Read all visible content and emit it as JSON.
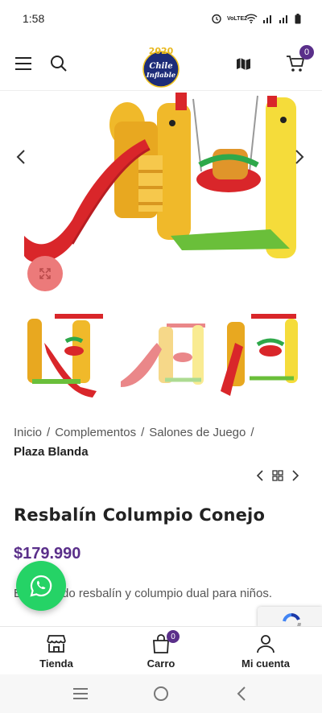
{
  "status_bar": {
    "time": "1:58",
    "network": "VoLTE2"
  },
  "header": {
    "logo_text": "Chile Inflable",
    "logo_year": "2020",
    "cart_count": "0"
  },
  "breadcrumb": {
    "items": [
      "Inicio",
      "Complementos",
      "Salones de Juego"
    ],
    "current": "Plaza Blanda"
  },
  "product": {
    "title": "Resbalín Columpio Conejo",
    "price": "$179.990",
    "description": "Entretenido resbalín y columpio dual para niños."
  },
  "bottom_nav": {
    "items": [
      {
        "label": "Tienda",
        "icon": "store-icon"
      },
      {
        "label": "Carro",
        "icon": "cart-icon",
        "badge": "0"
      },
      {
        "label": "Mi cuenta",
        "icon": "user-icon"
      }
    ]
  },
  "colors": {
    "accent": "#5a2f8a",
    "whatsapp": "#25d366",
    "zoom": "#ec7a7a"
  }
}
